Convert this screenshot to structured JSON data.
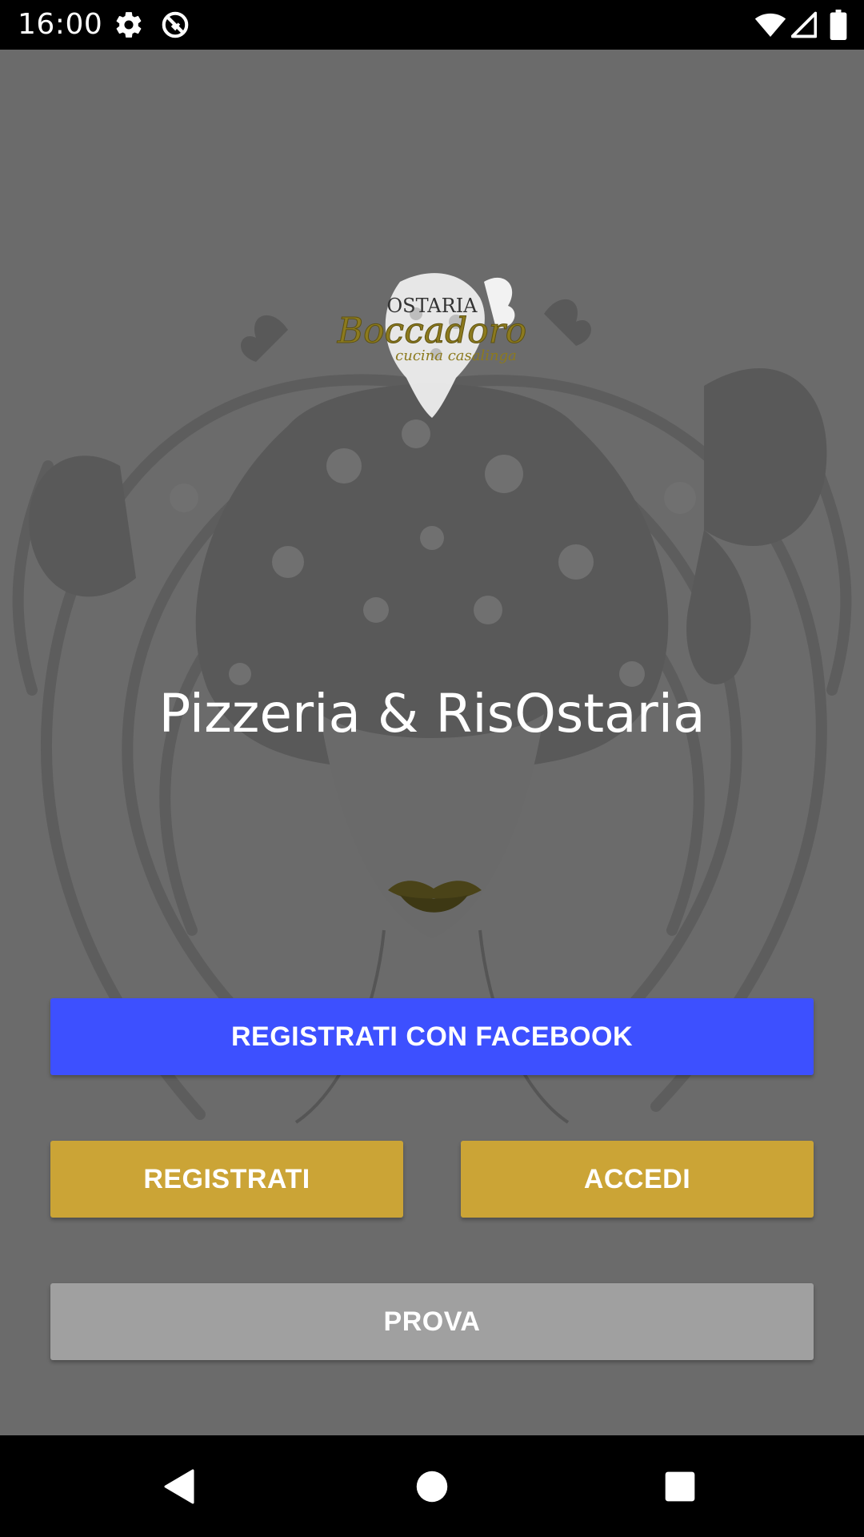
{
  "status_bar": {
    "time": "16:00",
    "icons": [
      "gear-icon",
      "sync-off-icon",
      "wifi-icon",
      "signal-icon",
      "battery-icon"
    ]
  },
  "brand": {
    "logo_text_top": "OSTARIA",
    "logo_text_main": "Boccadoro",
    "logo_text_sub": "cucina casalinga",
    "headline": "Pizzeria & RisOstaria"
  },
  "actions": {
    "facebook_label": "REGISTRATI CON FACEBOOK",
    "register_label": "REGISTRATI",
    "login_label": "ACCEDI",
    "try_label": "PROVA"
  },
  "colors": {
    "background": "#6b6b6b",
    "facebook": "#3d50ff",
    "gold": "#cba436",
    "prova": "#a0a0a0",
    "lips": "#4a4318"
  },
  "nav_bar": {
    "icons": [
      "back-icon",
      "home-icon",
      "recents-icon"
    ]
  }
}
